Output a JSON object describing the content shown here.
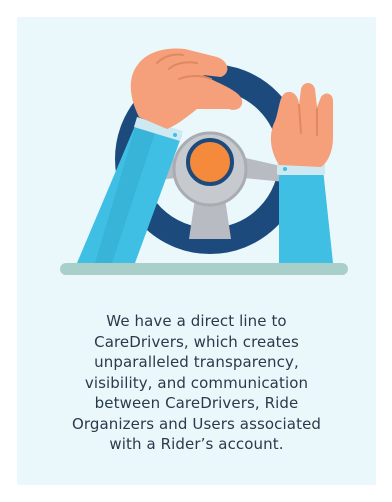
{
  "feature_card": {
    "illustration": {
      "icon": "steering-wheel-icon",
      "colors": {
        "background": "#eaf8fc",
        "wheel_rim": "#1d4a7c",
        "wheel_hub": "#b8bcc2",
        "center_button": "#f58a3c",
        "sleeve": "#3fbfe3",
        "hand": "#f5a07b",
        "shadow_base": "#a8cfc9"
      }
    },
    "description_lines": [
      "We have a direct line to",
      "CareDrivers, which creates",
      "unparalleled transparency,",
      "visibility, and communication",
      "between CareDrivers, Ride",
      "Organizers and Users associated",
      "with a Rider’s account."
    ]
  }
}
